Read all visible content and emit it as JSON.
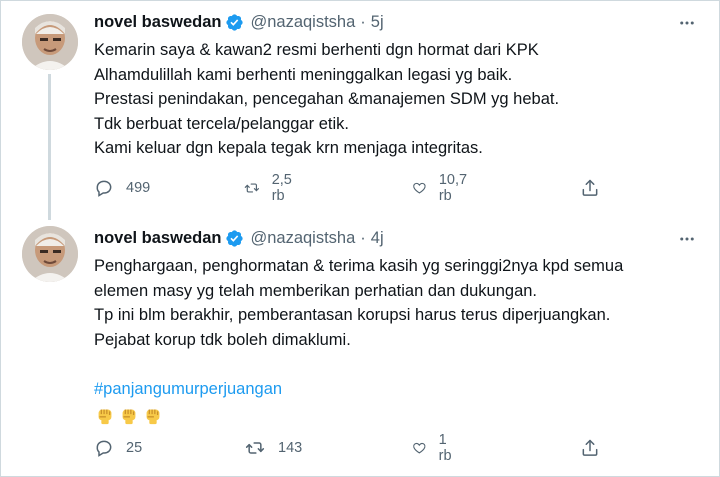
{
  "colors": {
    "accent": "#1d9bf0",
    "text": "#0f1419",
    "muted": "#536471",
    "border": "#cfd9de"
  },
  "icons": {
    "verified": "verified-badge-icon",
    "more": "more-dots-icon",
    "reply": "reply-icon",
    "retweet": "retweet-icon",
    "like": "heart-icon",
    "share": "share-icon",
    "emoji": "raised-fist-emoji"
  },
  "tweets": [
    {
      "name": "novel baswedan",
      "handle": "@nazaqistsha",
      "separator": "·",
      "time": "5j",
      "lines": [
        "Kemarin saya & kawan2 resmi berhenti dgn hormat dari KPK",
        "Alhamdulillah kami berhenti meninggalkan legasi yg baik.",
        "Prestasi penindakan, pencegahan &manajemen SDM yg hebat.",
        "Tdk berbuat tercela/pelanggar etik.",
        "Kami keluar dgn kepala tegak krn menjaga integritas."
      ],
      "replies": "499",
      "retweets": "2,5 rb",
      "likes": "10,7 rb"
    },
    {
      "name": "novel baswedan",
      "handle": "@nazaqistsha",
      "separator": "·",
      "time": "4j",
      "lines": [
        "Penghargaan, penghormatan & terima kasih yg seringgi2nya kpd semua",
        "elemen masy yg telah memberikan perhatian dan dukungan.",
        "Tp ini blm berakhir, pemberantasan korupsi harus terus diperjuangkan.",
        "Pejabat korup tdk boleh dimaklumi."
      ],
      "hashtag": "#panjangumurperjuangan",
      "emoji_count": 3,
      "replies": "25",
      "retweets": "143",
      "likes": "1 rb"
    }
  ]
}
